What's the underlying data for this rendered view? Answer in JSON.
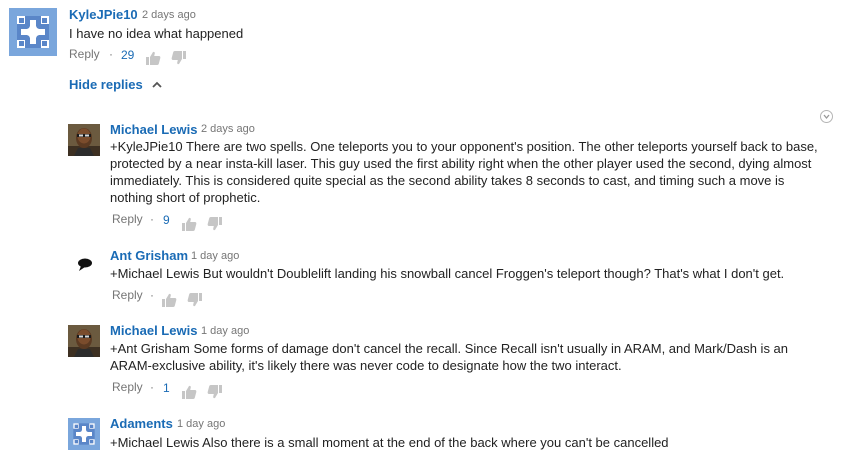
{
  "comment": {
    "author": "KyleJPie10",
    "time": "2 days ago",
    "text": "I have no idea what happened",
    "reply_label": "Reply",
    "dot": "·",
    "likes": "29"
  },
  "hide_replies_label": "Hide replies",
  "replies": [
    {
      "author": "Michael Lewis",
      "time": "2 days ago",
      "text": "+KyleJPie10 There are two spells. One teleports you to your opponent's position. The other teleports yourself back to base, protected by a near insta-kill laser. This guy used the first ability right when the other player used the second, dying almost immediately. This is considered quite special as the second ability takes 8 seconds to cast, and timing such a move is nothing short of prophetic.",
      "reply_label": "Reply",
      "dot": "·",
      "likes": "9"
    },
    {
      "author": "Ant Grisham",
      "time": "1 day ago",
      "text": "+Michael Lewis But wouldn't Doublelift landing his snowball cancel Froggen's teleport though? That's what I don't get.",
      "reply_label": "Reply",
      "dot": "·"
    },
    {
      "author": "Michael Lewis",
      "time": "1 day ago",
      "text": "+Ant Grisham Some forms of damage don't cancel the recall. Since Recall isn't usually in ARAM, and Mark/Dash is an ARAM-exclusive ability, it's likely there was never code to designate how the two interact.",
      "reply_label": "Reply",
      "dot": "·",
      "likes": "1"
    },
    {
      "author": "Adaments",
      "time": "1 day ago",
      "text": "+Michael Lewis Also there is a small moment at the end of the back where you can't be cancelled"
    }
  ],
  "icons": {
    "thumb_up": "thumb-up-icon",
    "thumb_down": "thumb-down-icon",
    "chevron": "chevron-up-icon",
    "menu": "dropdown-menu-icon",
    "default_avatar": "default-avatar-icon",
    "speech": "speech-bubble-icon"
  },
  "colors": {
    "link": "#1a6bb5",
    "meta": "#767676",
    "default_avatar_bg": "#7aa6dc"
  }
}
